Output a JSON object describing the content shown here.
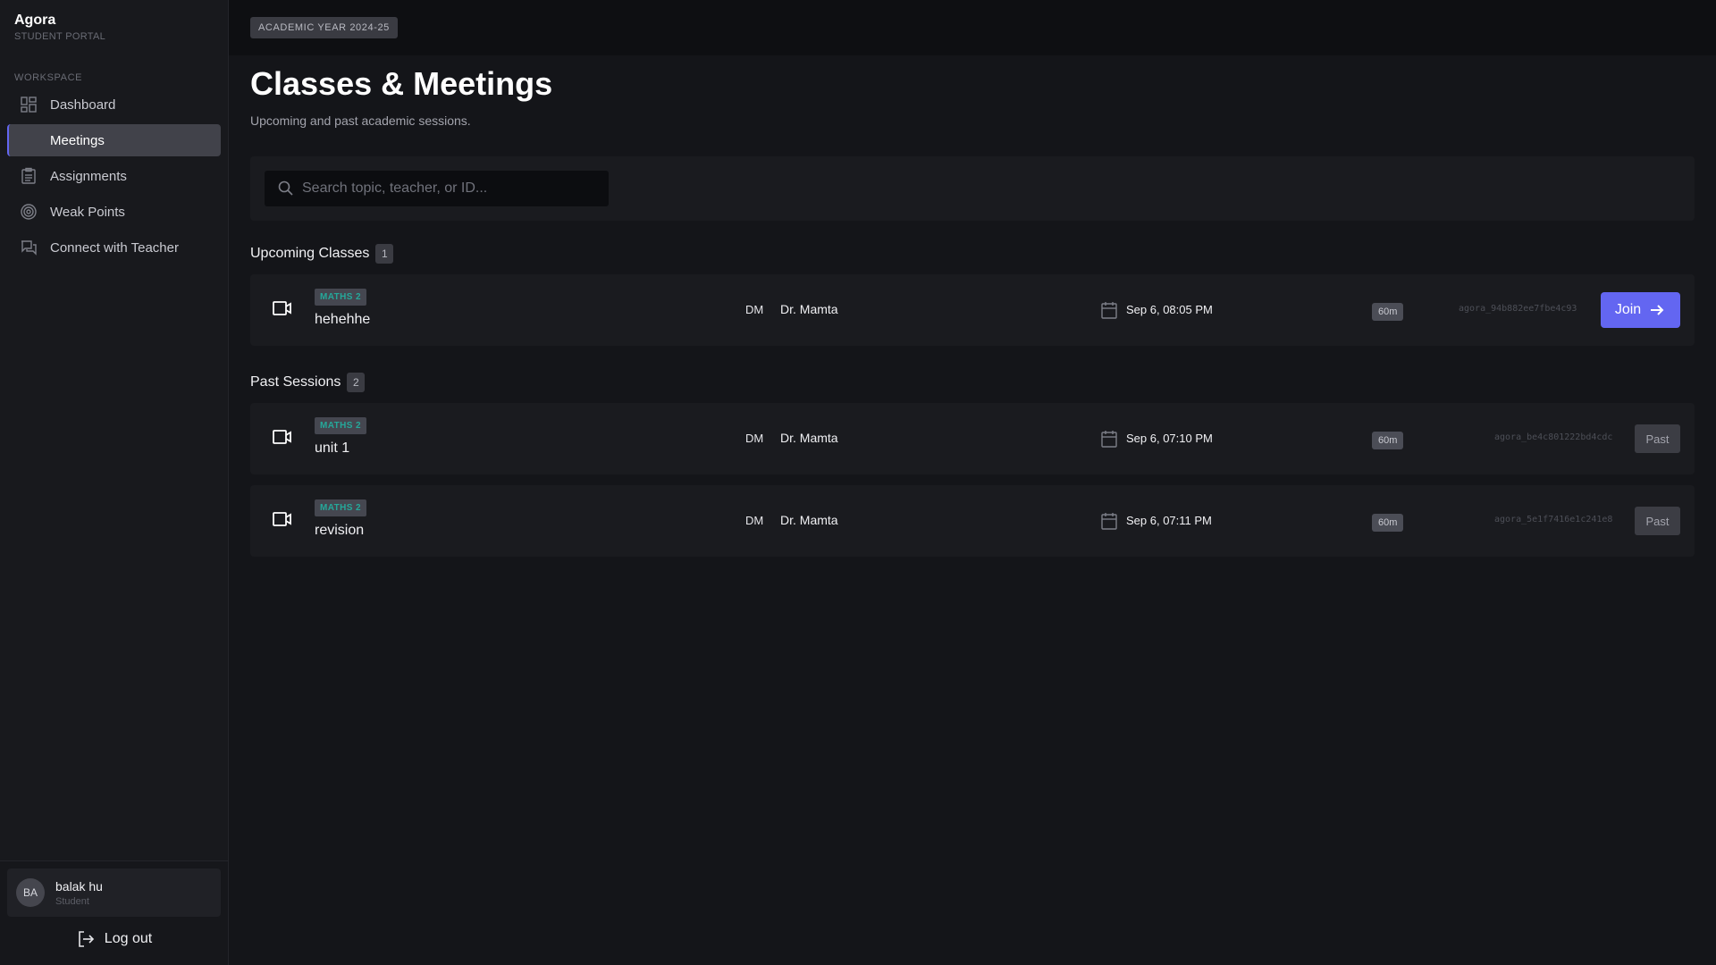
{
  "brand": {
    "name": "Agora",
    "subtitle": "STUDENT PORTAL"
  },
  "sidebar": {
    "section_label": "WORKSPACE",
    "items": [
      {
        "label": "Dashboard",
        "icon": "dashboard-icon"
      },
      {
        "label": "Meetings",
        "icon": "none",
        "active": true
      },
      {
        "label": "Assignments",
        "icon": "clipboard-icon"
      },
      {
        "label": "Weak Points",
        "icon": "target-icon"
      },
      {
        "label": "Connect with Teacher",
        "icon": "chat-icon"
      }
    ]
  },
  "user": {
    "initials": "BA",
    "name": "balak hu",
    "role": "Student"
  },
  "logout": {
    "label": "Log out"
  },
  "header": {
    "badge": "ACADEMIC YEAR 2024-25"
  },
  "page": {
    "title": "Classes & Meetings",
    "subtitle": "Upcoming and past academic sessions."
  },
  "search": {
    "placeholder": "Search topic, teacher, or ID..."
  },
  "upcoming": {
    "title": "Upcoming Classes",
    "count": "1",
    "sessions": [
      {
        "subject": "MATHS 2",
        "title": "hehehhe",
        "teacher_initials": "DM",
        "teacher": "Dr. Mamta",
        "datetime": "Sep 6, 08:05 PM",
        "duration": "60m",
        "meeting_id": "agora_94b882ee7fbe4c93",
        "action": "Join"
      }
    ]
  },
  "past": {
    "title": "Past Sessions",
    "count": "2",
    "sessions": [
      {
        "subject": "MATHS 2",
        "title": "unit 1",
        "teacher_initials": "DM",
        "teacher": "Dr. Mamta",
        "datetime": "Sep 6, 07:10 PM",
        "duration": "60m",
        "meeting_id": "agora_be4c801222bd4cdc",
        "action": "Past"
      },
      {
        "subject": "MATHS 2",
        "title": "revision",
        "teacher_initials": "DM",
        "teacher": "Dr. Mamta",
        "datetime": "Sep 6, 07:11 PM",
        "duration": "60m",
        "meeting_id": "agora_5e1f7416e1c241e8",
        "action": "Past"
      }
    ]
  },
  "colors": {
    "accent": "#6366f1",
    "subject_tag_text": "#25a89a",
    "background": "#141519",
    "sidebar": "#18191d"
  }
}
